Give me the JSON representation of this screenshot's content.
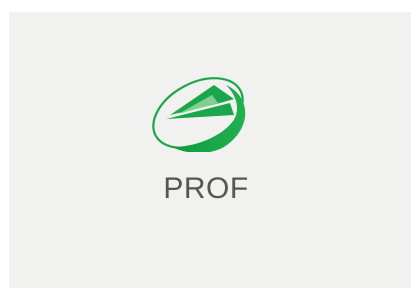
{
  "brand": {
    "name": "PROF",
    "logo_icon": "green-mountain-oval-icon",
    "colors": {
      "logo_green": "#1aa64a",
      "logo_green_light": "#7fd08f",
      "text_gray": "#555555",
      "card_background": "#f1f1f0"
    }
  }
}
